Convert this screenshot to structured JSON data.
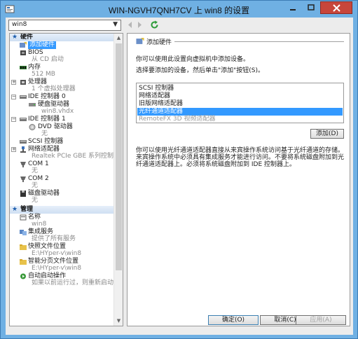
{
  "window": {
    "title": "WIN-NGVH7QNH7CV 上 win8 的设置"
  },
  "toolbar": {
    "vm_name": "win8"
  },
  "sidebar": {
    "section_hardware": "硬件",
    "section_management": "管理",
    "items": {
      "add_hardware": {
        "label": "添加硬件"
      },
      "bios": {
        "label": "BIOS",
        "sub": "从 CD 启动"
      },
      "memory": {
        "label": "内存",
        "sub": "512 MB"
      },
      "processor": {
        "label": "处理器",
        "sub": "1 个虚拟处理器"
      },
      "ide0": {
        "label": "IDE 控制器 0"
      },
      "hdd": {
        "label": "硬盘驱动器",
        "sub": "win8.vhdx"
      },
      "ide1": {
        "label": "IDE 控制器 1"
      },
      "dvd": {
        "label": "DVD 驱动器",
        "sub": "无"
      },
      "scsi": {
        "label": "SCSI 控制器"
      },
      "nic": {
        "label": "网络适配器",
        "sub": "Realtek PCIe GBE 系列控制器 ..."
      },
      "com1": {
        "label": "COM 1",
        "sub": "无"
      },
      "com2": {
        "label": "COM 2",
        "sub": "无"
      },
      "floppy": {
        "label": "磁盘驱动器",
        "sub": "无"
      },
      "name": {
        "label": "名称",
        "sub": "win8"
      },
      "integration": {
        "label": "集成服务",
        "sub": "提供了所有服务"
      },
      "snapshot": {
        "label": "快照文件位置",
        "sub": "E:\\HYper-v\\win8"
      },
      "paging": {
        "label": "智能分页文件位置",
        "sub": "E:\\HYper-v\\win8"
      },
      "autostart": {
        "label": "自动启动操作",
        "sub": "如果以前运行过，则重新启动"
      }
    }
  },
  "panel": {
    "heading": "添加硬件",
    "intro": "你可以使用此设置向虚拟机中添加设备。",
    "prompt": "选择要添加的设备，然后单击\"添加\"按钮(S)。",
    "options": [
      "SCSI 控制器",
      "网络适配器",
      "旧版网络适配器",
      "光纤通道适配器",
      "RemoteFX 3D 视频适配器"
    ],
    "add_button": "添加(D)",
    "description": "你可以使用光纤通道适配器直接从来宾操作系统访问基于光纤通道的存储。来宾操作系统中必须具有集成服务才能进行访问。不要将系统磁盘附加到光纤通道适配器上。必须将系统磁盘附加到 IDE 控制器上。"
  },
  "footer": {
    "ok": "确定(O)",
    "cancel": "取消(C)",
    "apply": "应用(A)"
  },
  "colors": {
    "selection": "#3399ff",
    "title_bar": "#6fb0e3",
    "close": "#c7463b"
  }
}
